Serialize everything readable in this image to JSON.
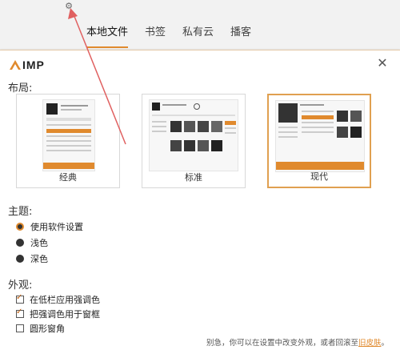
{
  "window": {
    "tabs": [
      {
        "label": "本地文件",
        "active": true
      },
      {
        "label": "书签",
        "active": false
      },
      {
        "label": "私有云",
        "active": false
      },
      {
        "label": "播客",
        "active": false
      }
    ],
    "settings_icon": "gear-icon"
  },
  "dialog": {
    "logo_text": "IMP",
    "close_icon": "close-icon",
    "layout_title": "布局:",
    "layouts": [
      {
        "label": "经典",
        "selected": false
      },
      {
        "label": "标准",
        "selected": false
      },
      {
        "label": "现代",
        "selected": true
      }
    ],
    "theme_title": "主题:",
    "themes": [
      {
        "label": "使用软件设置",
        "selected": true
      },
      {
        "label": "浅色",
        "selected": false
      },
      {
        "label": "深色",
        "selected": false
      }
    ],
    "appearance_title": "外观:",
    "appearance_options": [
      {
        "label": "在低栏应用强调色",
        "checked": true
      },
      {
        "label": "把强调色用于窗框",
        "checked": true
      },
      {
        "label": "圆形窗角",
        "checked": false
      }
    ],
    "footer_text": "别急，你可以在设置中改变外观，或者回滚至",
    "footer_link": "旧皮肤",
    "footer_end": "。"
  },
  "colors": {
    "accent": "#e08a2e",
    "selected_border": "#e0a050",
    "annotation_arrow": "#e06060"
  }
}
